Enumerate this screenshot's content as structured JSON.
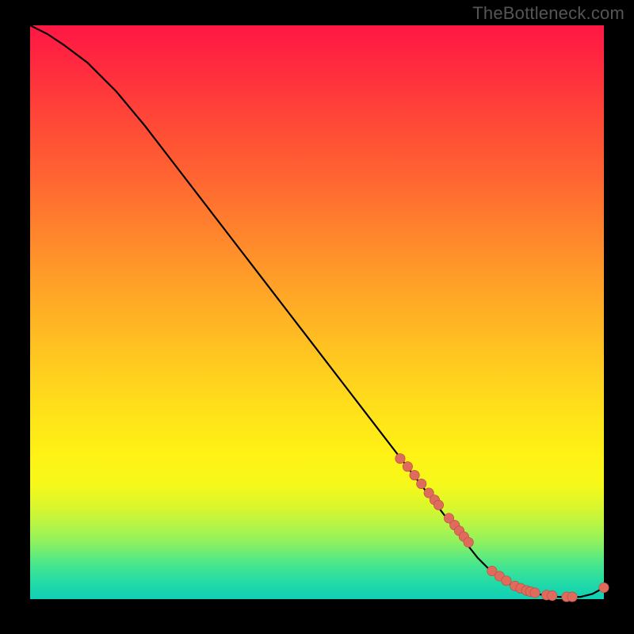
{
  "watermark": "TheBottleneck.com",
  "colors": {
    "curve": "#000000",
    "points": "#e06a5c",
    "points_stroke": "#b04c42"
  },
  "chart_data": {
    "type": "line",
    "title": "",
    "xlabel": "",
    "ylabel": "",
    "xlim": [
      0,
      100
    ],
    "ylim": [
      0,
      100
    ],
    "grid": false,
    "legend": false,
    "series": [
      {
        "name": "bottleneck-curve",
        "x": [
          0,
          3,
          6,
          10,
          15,
          20,
          25,
          30,
          35,
          40,
          45,
          50,
          55,
          60,
          65,
          70,
          75,
          78,
          80,
          82,
          84,
          86,
          88,
          90,
          92,
          94,
          96,
          98,
          100
        ],
        "y": [
          100,
          98.5,
          96.5,
          93.5,
          88.5,
          82.5,
          76,
          69.5,
          63,
          56.5,
          50,
          43.5,
          37,
          30.5,
          24,
          17.5,
          11,
          7.2,
          5.2,
          3.6,
          2.4,
          1.6,
          1.0,
          0.6,
          0.4,
          0.3,
          0.4,
          0.9,
          2.0
        ]
      }
    ],
    "points": {
      "name": "highlighted-points",
      "x": [
        64.5,
        65.8,
        67.0,
        68.2,
        69.5,
        70.5,
        71.2,
        73.0,
        74.0,
        74.8,
        75.6,
        76.4,
        80.5,
        81.8,
        83.0,
        84.5,
        85.5,
        86.5,
        87.2,
        88.0,
        90.0,
        91.0,
        93.5,
        94.5,
        100
      ],
      "y": [
        24.5,
        23.1,
        21.6,
        20.1,
        18.5,
        17.3,
        16.4,
        14.1,
        12.9,
        11.9,
        10.9,
        9.9,
        4.9,
        4.0,
        3.2,
        2.3,
        1.9,
        1.5,
        1.3,
        1.1,
        0.7,
        0.6,
        0.4,
        0.4,
        2.0
      ]
    }
  }
}
